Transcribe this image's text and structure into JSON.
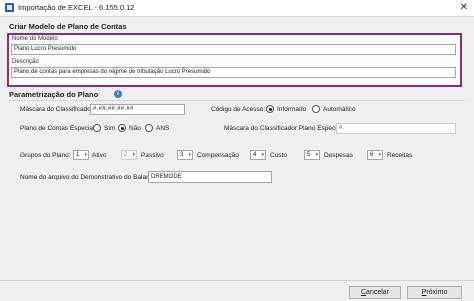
{
  "window": {
    "title": "Importação de EXCEL - 6.155.0.12",
    "close_glyph": "✕"
  },
  "modelo": {
    "heading": "Criar Modelo de Plano de Contas",
    "nome_label": "Nome do Modelo",
    "nome_value": "Plano Lucro Presumido",
    "descricao_label": "Descrição",
    "descricao_value": "Plano de contas para empresas do regime de tributação Lucro Presumido"
  },
  "parametrizacao": {
    "heading": "Parametrização do Plano",
    "info_glyph": "i",
    "mascara_label": "Máscara do Classificador:",
    "mascara_value": "#.##.##.##.##",
    "codigo_acesso_label": "Código de Acesso:",
    "codigo_options": [
      {
        "label": "Informado",
        "selected": true
      },
      {
        "label": "Automático",
        "selected": false
      }
    ],
    "plano_especial_label": "Plano de Contas Especial:",
    "plano_especial_options": [
      {
        "label": "Sim",
        "selected": false
      },
      {
        "label": "Não",
        "selected": true
      },
      {
        "label": "ANS",
        "selected": false
      }
    ],
    "mascara_especial_label": "Máscara do Classificador Plano Especial:",
    "mascara_especial_value": "#.",
    "grupos_label": "Grupos do Plano:",
    "grupos": [
      {
        "value": "1",
        "label": "Ativo",
        "enabled": true
      },
      {
        "value": "2",
        "label": "Passivo",
        "enabled": false
      },
      {
        "value": "3",
        "label": "Compensação",
        "enabled": true
      },
      {
        "value": "4",
        "label": "Custo",
        "enabled": true
      },
      {
        "value": "5",
        "label": "Despesas",
        "enabled": true
      },
      {
        "value": "6",
        "label": "Receitas",
        "enabled": true
      }
    ],
    "spin_arrow": "▾",
    "arquivo_label": "Nome do arquivo do Demonstrativo do Balanço:",
    "arquivo_value": "DREMODE"
  },
  "footer": {
    "cancel_u": "C",
    "cancel_rest": "ancelar",
    "next_u": "P",
    "next_rest": "róximo"
  }
}
